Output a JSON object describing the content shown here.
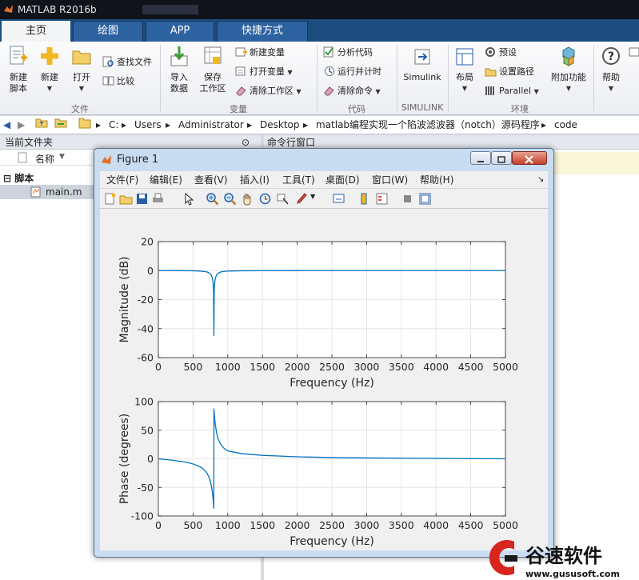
{
  "window": {
    "title": "MATLAB R2016b"
  },
  "tabs": [
    {
      "label": "主页",
      "active": true
    },
    {
      "label": "绘图",
      "active": false
    },
    {
      "label": "APP",
      "active": false
    },
    {
      "label": "快捷方式",
      "active": false
    }
  ],
  "ribbon": {
    "new_script": "新建\n脚本",
    "new": "新建",
    "open": "打开",
    "find_files": "查找文件",
    "compare": "比较",
    "import_data": "导入\n数据",
    "save_workspace": "保存\n工作区",
    "new_variable": "新建变量",
    "open_variable": "打开变量",
    "clear_workspace": "清除工作区",
    "analyze_code": "分析代码",
    "run_and_time": "运行并计时",
    "clear_commands": "清除命令",
    "simulink": "Simulink",
    "layout": "布局",
    "preferences": "预设",
    "set_path": "设置路径",
    "parallel": "Parallel",
    "add_ons": "附加功能",
    "help": "帮助",
    "groups": {
      "file": "文件",
      "variable": "变量",
      "code": "代码",
      "simulink": "SIMULINK",
      "environment": "环境"
    }
  },
  "address": {
    "segments": [
      "C:",
      "Users",
      "Administrator",
      "Desktop",
      "matlab编程实现一个陷波滤波器（notch）源码程序",
      "code"
    ]
  },
  "left_panel": {
    "title": "当前文件夹",
    "column_name": "名称",
    "group_label": "脚本",
    "files": [
      "main.m"
    ]
  },
  "command_window": {
    "title": "命令行窗口"
  },
  "figure": {
    "title": "Figure 1",
    "menu": [
      "文件(F)",
      "编辑(E)",
      "查看(V)",
      "插入(I)",
      "工具(T)",
      "桌面(D)",
      "窗口(W)",
      "帮助(H)"
    ]
  },
  "chart_data": [
    {
      "type": "line",
      "xlabel": "Frequency (Hz)",
      "ylabel": "Magnitude (dB)",
      "xlim": [
        0,
        5000
      ],
      "ylim": [
        -60,
        20
      ],
      "xticks": [
        0,
        500,
        1000,
        1500,
        2000,
        2500,
        3000,
        3500,
        4000,
        4500,
        5000
      ],
      "yticks": [
        -60,
        -40,
        -20,
        0,
        20
      ],
      "grid": true,
      "series": [
        {
          "color": "#0072bd",
          "x": [
            0,
            300,
            500,
            600,
            700,
            740,
            760,
            780,
            790,
            795,
            800,
            805,
            810,
            820,
            840,
            860,
            900,
            1000,
            1200,
            1500,
            2000,
            3000,
            4000,
            5000
          ],
          "y": [
            0,
            -0.03,
            -0.1,
            -0.3,
            -0.9,
            -1.8,
            -2.8,
            -5.5,
            -9,
            -14,
            -45,
            -14,
            -9,
            -5.5,
            -2.8,
            -1.8,
            -0.9,
            -0.3,
            -0.1,
            -0.05,
            -0.02,
            0,
            0,
            0
          ]
        }
      ]
    },
    {
      "type": "line",
      "xlabel": "Frequency (Hz)",
      "ylabel": "Phase (degrees)",
      "xlim": [
        0,
        5000
      ],
      "ylim": [
        -100,
        100
      ],
      "xticks": [
        0,
        500,
        1000,
        1500,
        2000,
        2500,
        3000,
        3500,
        4000,
        4500,
        5000
      ],
      "yticks": [
        -100,
        -50,
        0,
        50,
        100
      ],
      "grid": true,
      "series": [
        {
          "color": "#0072bd",
          "x": [
            0,
            200,
            400,
            500,
            600,
            650,
            700,
            740,
            760,
            780,
            790,
            795,
            799,
            801,
            805,
            810,
            820,
            840,
            860,
            900,
            950,
            1000,
            1200,
            1500,
            2000,
            2500,
            3000,
            4000,
            5000
          ],
          "y": [
            0,
            -2.5,
            -6,
            -9,
            -14,
            -18,
            -25,
            -35,
            -45,
            -60,
            -72,
            -80,
            -87,
            88,
            80,
            72,
            60,
            45,
            35,
            25,
            18,
            14,
            9,
            6,
            3.5,
            2.2,
            1.5,
            0.7,
            0
          ]
        }
      ]
    }
  ],
  "watermark": {
    "brand": "谷速软件",
    "url": "www.gususoft.com"
  }
}
